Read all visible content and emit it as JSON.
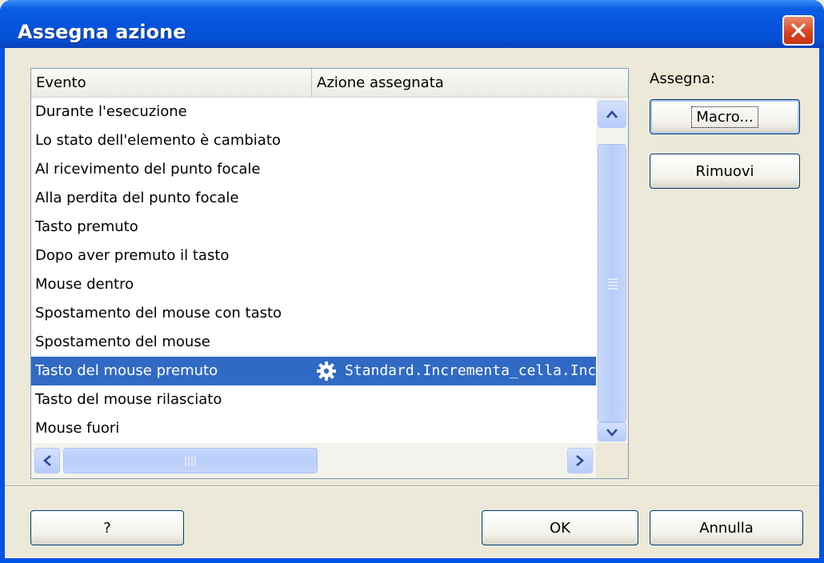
{
  "window": {
    "title": "Assegna azione"
  },
  "list": {
    "columns": [
      "Evento",
      "Azione assegnata"
    ],
    "rows": [
      {
        "event": "Durante l'esecuzione",
        "action": ""
      },
      {
        "event": "Lo stato dell'elemento è cambiato",
        "action": ""
      },
      {
        "event": "Al ricevimento del punto focale",
        "action": ""
      },
      {
        "event": "Alla perdita del punto focale",
        "action": ""
      },
      {
        "event": "Tasto premuto",
        "action": ""
      },
      {
        "event": "Dopo aver premuto il tasto",
        "action": ""
      },
      {
        "event": "Mouse dentro",
        "action": ""
      },
      {
        "event": "Spostamento del mouse con tasto",
        "action": ""
      },
      {
        "event": "Spostamento del mouse",
        "action": ""
      },
      {
        "event": "Tasto del mouse premuto",
        "action": "Standard.Incrementa_cella.Incre",
        "selected": true,
        "icon": "gear-icon"
      },
      {
        "event": "Tasto del mouse rilasciato",
        "action": ""
      },
      {
        "event": "Mouse fuori",
        "action": ""
      }
    ]
  },
  "side": {
    "assign_label": "Assegna:",
    "macro_button": "Macro...",
    "remove_button": "Rimuovi"
  },
  "footer": {
    "help_button": "?",
    "ok_button": "OK",
    "cancel_button": "Annulla"
  },
  "colors": {
    "selection": "#316ac5",
    "titlebar": "#0553dd",
    "dialog_bg": "#ece9d8"
  }
}
